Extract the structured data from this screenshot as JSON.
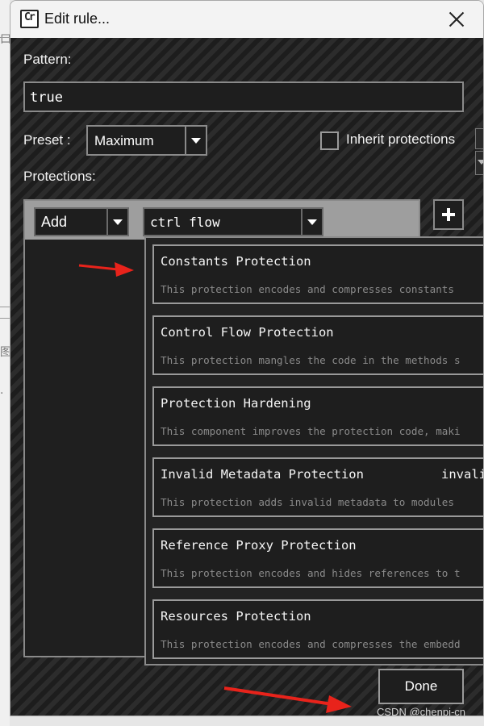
{
  "window": {
    "title": "Edit rule...",
    "app_icon_text": "Cr"
  },
  "form": {
    "pattern_label": "Pattern:",
    "pattern_value": "true",
    "preset_label": "Preset :",
    "preset_value": "Maximum",
    "inherit_label": "Inherit protections",
    "inherit_checked": false,
    "protections_label": "Protections:"
  },
  "toolbar": {
    "add_value": "Add",
    "filter_value": "ctrl flow"
  },
  "dropdown": {
    "items": [
      {
        "name": "Constants Protection",
        "desc": "This protection encodes and compresses constants"
      },
      {
        "name": "Control Flow Protection",
        "desc": "This protection mangles the code in the methods s"
      },
      {
        "name": "Protection Hardening",
        "desc": "This component improves the protection code, maki"
      },
      {
        "name": "Invalid Metadata Protection",
        "extra": "invali",
        "desc": "This protection adds invalid metadata to modules"
      },
      {
        "name": "Reference Proxy Protection",
        "desc": "This protection encodes and hides references to t"
      },
      {
        "name": "Resources Protection",
        "desc": "This protection encodes and compresses the embedd"
      }
    ]
  },
  "buttons": {
    "done_label": "Done"
  },
  "watermark": "CSDN @chenpi-cn",
  "colors": {
    "annotation_arrow": "#e8231b",
    "background": "#242424"
  }
}
